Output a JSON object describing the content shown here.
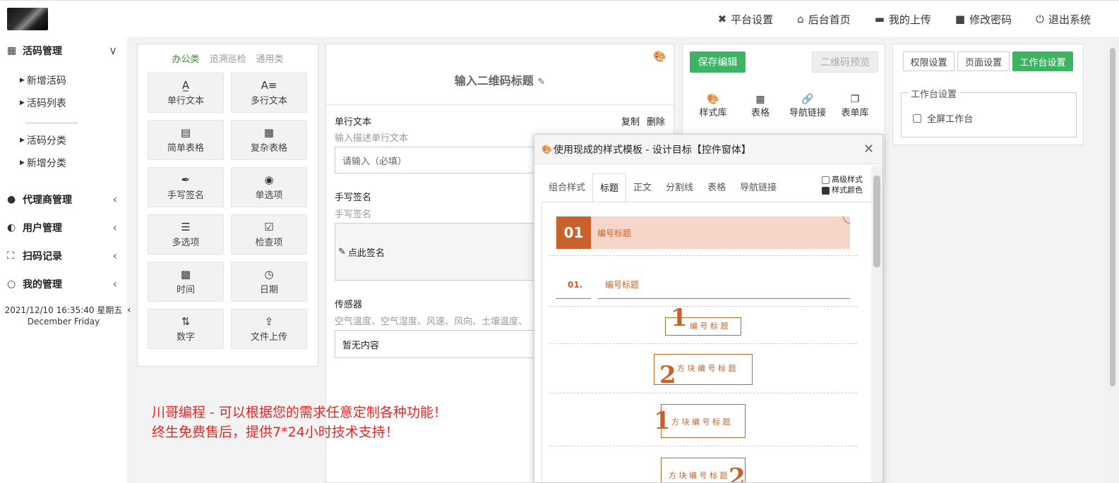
{
  "topnav": {
    "items": [
      {
        "icon": "wrench-icon",
        "glyph": "✕",
        "label": "平台设置"
      },
      {
        "icon": "home-icon",
        "glyph": "⌂",
        "label": "后台首页"
      },
      {
        "icon": "folder-icon",
        "glyph": "▬",
        "label": "我的上传"
      },
      {
        "icon": "lock-icon",
        "glyph": "🔒",
        "label": "修改密码"
      },
      {
        "icon": "power-icon",
        "glyph": "⏻",
        "label": "退出系统"
      }
    ]
  },
  "sidebar": {
    "groups": [
      {
        "label": "活码管理",
        "arrow": "∨"
      },
      {
        "label": "代理商管理",
        "arrow": "‹"
      },
      {
        "label": "用户管理",
        "arrow": "‹"
      },
      {
        "label": "扫码记录",
        "arrow": "‹"
      },
      {
        "label": "我的管理",
        "arrow": "‹"
      }
    ],
    "sub_items": [
      "新增活码",
      "活码列表",
      "活码分类",
      "新增分类"
    ],
    "time_line1": "2021/12/10 16:35:40 星期五",
    "time_line2": "December Friday"
  },
  "palette": {
    "tabs": [
      "办公类",
      "追溯巡检",
      "通用类"
    ],
    "buttons": [
      "单行文本",
      "多行文本",
      "简单表格",
      "复杂表格",
      "手写签名",
      "单选项",
      "多选项",
      "检查项",
      "时间",
      "日期",
      "数字",
      "文件上传"
    ]
  },
  "preview": {
    "title": "输入二维码标题",
    "copy": "复制",
    "delete": "删除",
    "field1_label": "单行文本",
    "field1_desc": "输入描述单行文本",
    "field1_placeholder": "请输入（必填）",
    "field2_label": "手写签名",
    "field2_desc": "手写签名",
    "field2_action": "点此签名",
    "field3_label": "传感器",
    "field3_desc": "空气温度、空气湿度、风速、风向、土壤温度、",
    "field3_value": "暂无内容"
  },
  "ad": {
    "line1": "川哥编程 - 可以根据您的需求任意定制各种功能！",
    "line2": "终生免费售后，提供7*24小时技术支持！"
  },
  "editor": {
    "save": "保存编辑",
    "preview_qr": "二维码预览",
    "tools": [
      "样式库",
      "表格",
      "导航链接",
      "表单库"
    ]
  },
  "settings": {
    "buttons": [
      "权限设置",
      "页面设置",
      "工作台设置"
    ],
    "legend": "工作台设置",
    "fullscreen": "全屏工作台"
  },
  "modal": {
    "title": "使用现成的样式模板 - 设计目标【控件窗体】",
    "tabs": [
      "组合样式",
      "标题",
      "正文",
      "分割线",
      "表格",
      "导航链接"
    ],
    "opt_advanced": "高级样式",
    "opt_color": "样式颜色",
    "tpl1_num": "01",
    "tpl1_text": "编号标题",
    "tpl2_num": "01.",
    "tpl2_text": "编号标题",
    "tpl3_num": "1",
    "tpl3_text": "编 号 标 题",
    "tpl4_num": "2",
    "tpl4_text": "方 块 编 号 标 题",
    "tpl5_num": "1",
    "tpl5_text": "方 块 编 号 标 题",
    "tpl6_num": "2",
    "tpl6_text": "方 块 编 号 标 题"
  }
}
